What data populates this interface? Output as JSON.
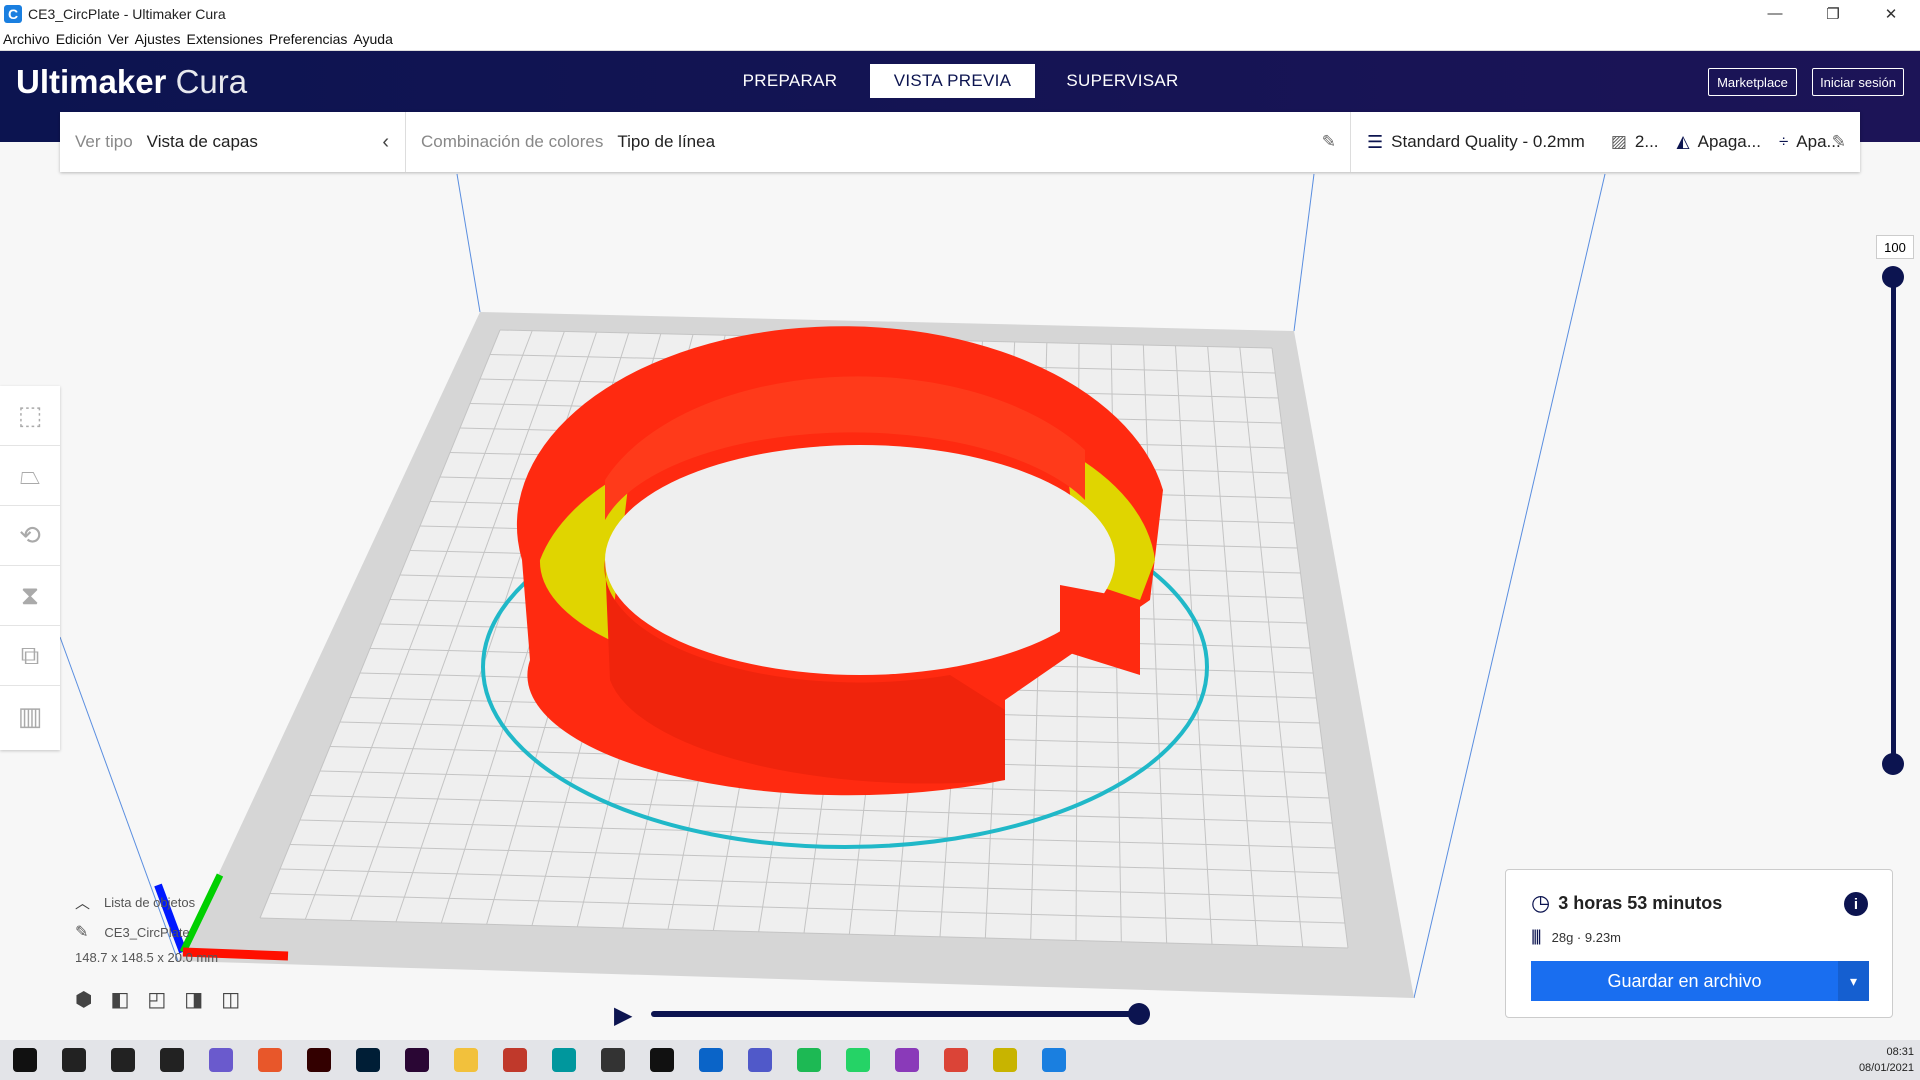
{
  "window": {
    "title": "CE3_CircPlate - Ultimaker Cura",
    "controls": [
      "—",
      "❐",
      "✕"
    ]
  },
  "menu": [
    "Archivo",
    "Edición",
    "Ver",
    "Ajustes",
    "Extensiones",
    "Preferencias",
    "Ayuda"
  ],
  "header": {
    "brand_bold": "Ultimaker",
    "brand_light": "Cura",
    "tabs": [
      {
        "label": "PREPARAR"
      },
      {
        "label": "VISTA PREVIA",
        "active": true
      },
      {
        "label": "SUPERVISAR"
      }
    ],
    "marketplace": "Marketplace",
    "signin": "Iniciar sesión"
  },
  "toolbar": {
    "view_type_label": "Ver tipo",
    "view_type_value": "Vista de capas",
    "color_scheme_label": "Combinación de colores",
    "color_scheme_value": "Tipo de línea",
    "quality": "Standard Quality - 0.2mm",
    "infill": "2...",
    "support": "Apaga...",
    "adhesion": "Apa..."
  },
  "left_tools": [
    "move-icon",
    "scale-icon",
    "rotate-icon",
    "mirror-icon",
    "per-model-settings-icon",
    "support-blocker-icon"
  ],
  "layer_slider": {
    "top_value": "100",
    "max": 100,
    "current": 100,
    "min_layer": 1
  },
  "object_list": {
    "title": "Lista de objetos",
    "object": "CE3_CircPlate",
    "dimensions": "148.7 x 148.5 x 20.0 mm"
  },
  "view_buttons": [
    "3d-view",
    "front-view",
    "top-view",
    "left-view",
    "right-view"
  ],
  "simulation": {
    "progress": 1.0
  },
  "print_info": {
    "time": "3 horas 53 minutos",
    "material": "28g · 9.23m",
    "save_button": "Guardar en archivo"
  },
  "colors": {
    "navy": "#0c1450",
    "accent": "#196ef0",
    "wall": "#ff2a10",
    "infill": "#e0d500",
    "skirt": "#20b8c8"
  },
  "taskbar": {
    "time": "08:31",
    "date": "08/01/2021",
    "icons": [
      {
        "name": "start",
        "color": "#111"
      },
      {
        "name": "search",
        "color": "#222"
      },
      {
        "name": "cortana",
        "color": "#222"
      },
      {
        "name": "task-view",
        "color": "#222"
      },
      {
        "name": "app",
        "color": "#6a5acd"
      },
      {
        "name": "cura-orange",
        "color": "#e8572a"
      },
      {
        "name": "illustrator",
        "color": "#330000"
      },
      {
        "name": "photoshop",
        "color": "#001e36"
      },
      {
        "name": "premiere",
        "color": "#2a0634"
      },
      {
        "name": "explorer",
        "color": "#f2c13c"
      },
      {
        "name": "app-red",
        "color": "#c0392b"
      },
      {
        "name": "arduino",
        "color": "#00979d"
      },
      {
        "name": "store",
        "color": "#333"
      },
      {
        "name": "netflix",
        "color": "#111"
      },
      {
        "name": "mail",
        "color": "#0a64c8"
      },
      {
        "name": "teams",
        "color": "#5059c9"
      },
      {
        "name": "spotify",
        "color": "#1db954"
      },
      {
        "name": "whatsapp",
        "color": "#25d366"
      },
      {
        "name": "instagram",
        "color": "#8a3ab9"
      },
      {
        "name": "chrome",
        "color": "#db4437"
      },
      {
        "name": "app-yellow",
        "color": "#c8b400"
      },
      {
        "name": "cura",
        "color": "#1a7fe0"
      }
    ]
  }
}
